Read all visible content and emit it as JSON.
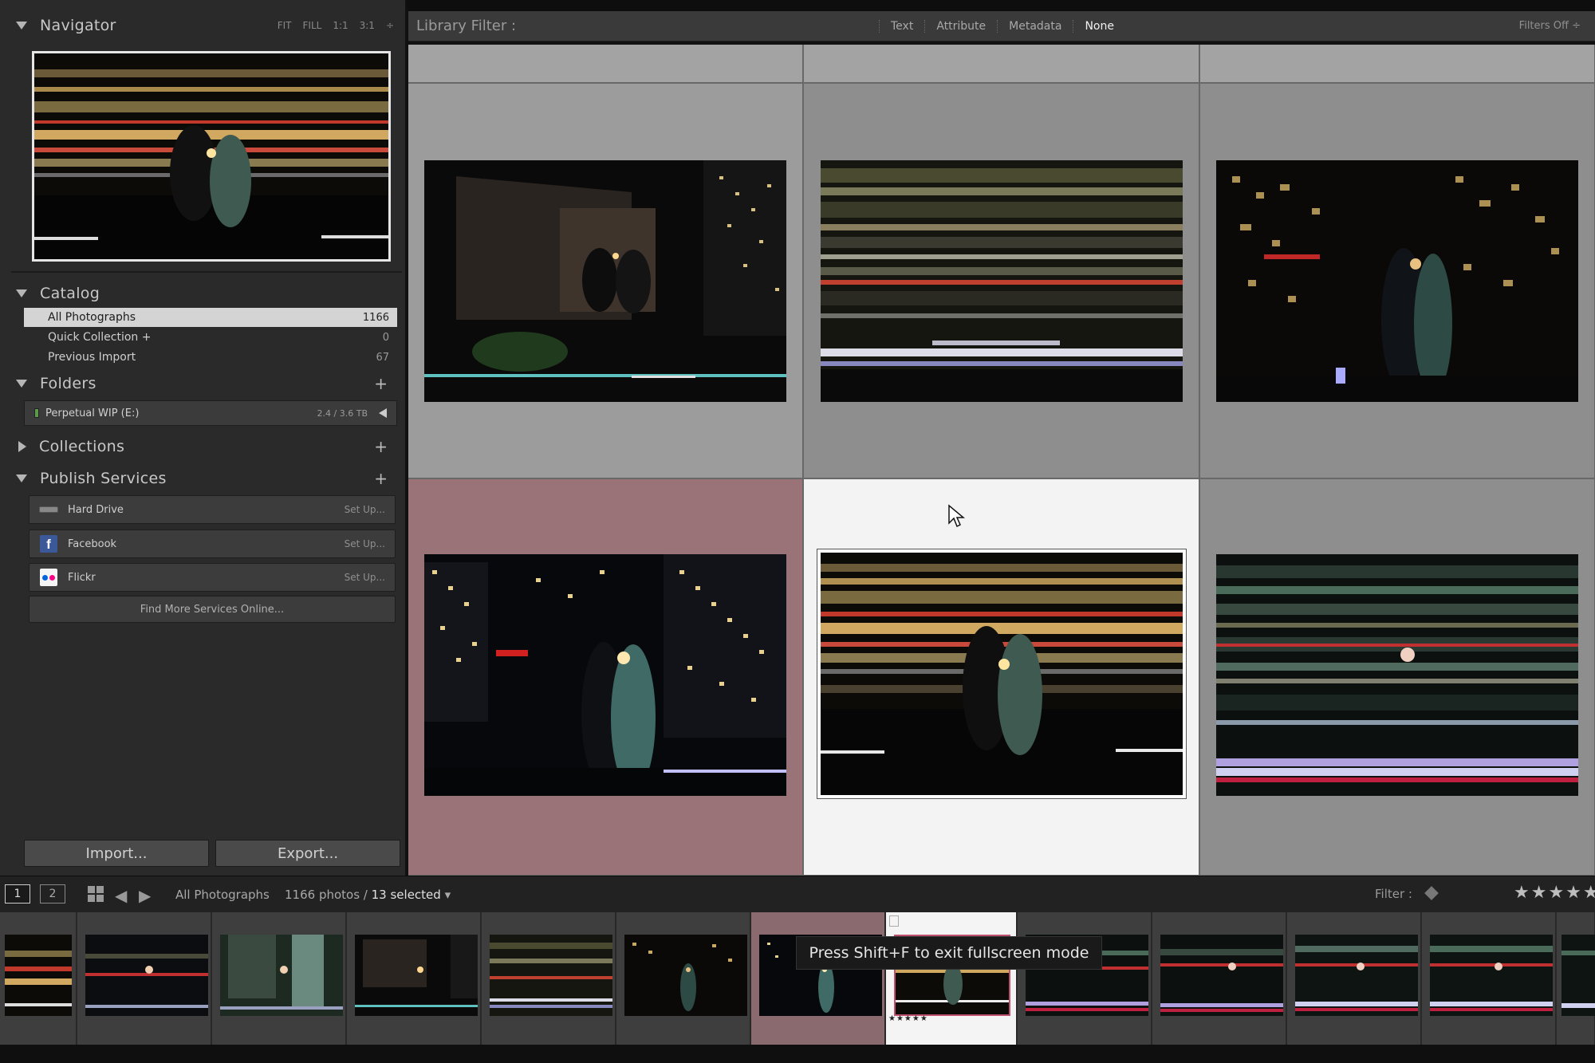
{
  "navigator": {
    "title": "Navigator",
    "zoom_options": [
      "FIT",
      "FILL",
      "1:1",
      "3:1"
    ]
  },
  "catalog": {
    "title": "Catalog",
    "rows": [
      {
        "label": "All Photographs",
        "count": "1166"
      },
      {
        "label": "Quick Collection +",
        "count": "0"
      },
      {
        "label": "Previous Import",
        "count": "67"
      }
    ]
  },
  "folders": {
    "title": "Folders",
    "folder": {
      "label": "Perpetual WIP (E:)",
      "size": "2.4 / 3.6 TB"
    }
  },
  "collections": {
    "title": "Collections"
  },
  "publish": {
    "title": "Publish Services",
    "services": [
      {
        "label": "Hard Drive",
        "action": "Set Up..."
      },
      {
        "label": "Facebook",
        "action": "Set Up..."
      },
      {
        "label": "Flickr",
        "action": "Set Up..."
      }
    ],
    "find_more": "Find More Services Online..."
  },
  "buttons": {
    "import": "Import...",
    "export": "Export..."
  },
  "filter_bar": {
    "label": "Library Filter :",
    "options": [
      "Text",
      "Attribute",
      "Metadata",
      "None"
    ],
    "active": "None",
    "filters_off": "Filters Off ÷"
  },
  "filmstrip_toolbar": {
    "screen1": "1",
    "screen2": "2",
    "source": "All Photographs",
    "count": "1166 photos /",
    "selected": "13 selected",
    "filter_label": "Filter :",
    "stars": "★★★★★"
  },
  "tooltip": "Press Shift+F to exit fullscreen mode",
  "film_stars": "★★★★★",
  "colors": {
    "panel_bg": "#2a2a2a",
    "grid_bg": "#9c9c9c",
    "selected_cell": "#f3f3f3",
    "pink_cell": "#9a7378"
  }
}
